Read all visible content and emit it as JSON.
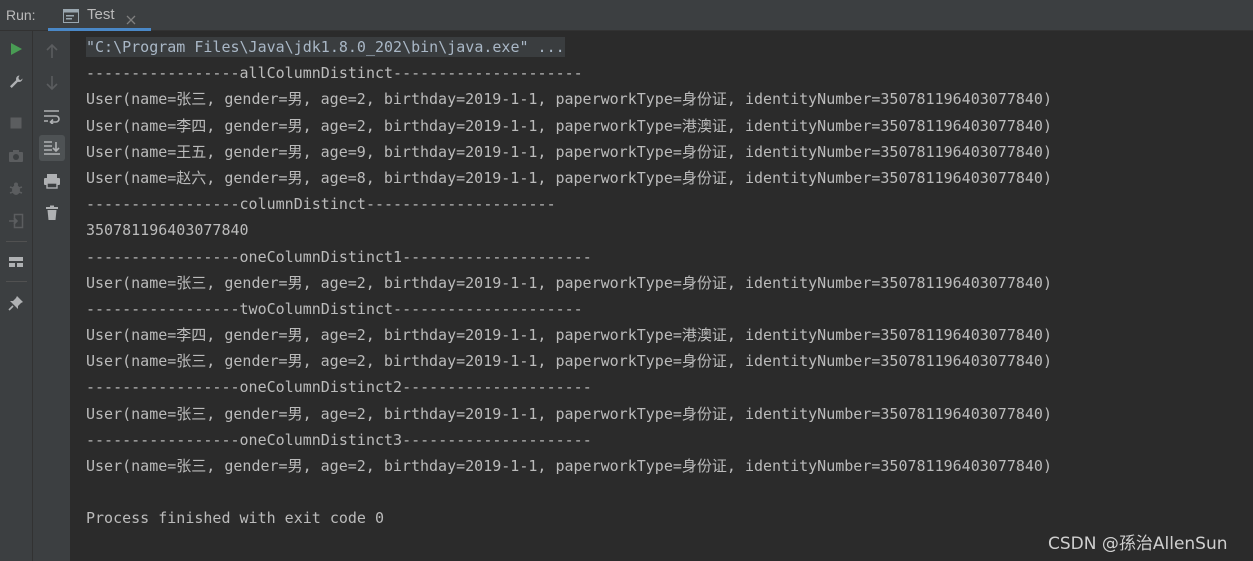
{
  "topbar": {
    "run_label": "Run:",
    "tab_title": "Test"
  },
  "toolbar_left": [
    "run-icon",
    "wrench-icon",
    "stop-icon",
    "camera-icon",
    "bug-settings-icon",
    "exit-icon",
    "layout-icon",
    "pin-icon"
  ],
  "toolbar_right": [
    "arrow-up-icon",
    "arrow-down-icon",
    "soft-wrap-icon",
    "scroll-to-end-icon",
    "print-icon",
    "trash-icon"
  ],
  "console": {
    "lines": [
      "\"C:\\Program Files\\Java\\jdk1.8.0_202\\bin\\java.exe\" ...",
      "-----------------allColumnDistinct---------------------",
      "User(name=张三, gender=男, age=2, birthday=2019-1-1, paperworkType=身份证, identityNumber=350781196403077840)",
      "User(name=李四, gender=男, age=2, birthday=2019-1-1, paperworkType=港澳证, identityNumber=350781196403077840)",
      "User(name=王五, gender=男, age=9, birthday=2019-1-1, paperworkType=身份证, identityNumber=350781196403077840)",
      "User(name=赵六, gender=男, age=8, birthday=2019-1-1, paperworkType=身份证, identityNumber=350781196403077840)",
      "-----------------columnDistinct---------------------",
      "350781196403077840",
      "-----------------oneColumnDistinct1---------------------",
      "User(name=张三, gender=男, age=2, birthday=2019-1-1, paperworkType=身份证, identityNumber=350781196403077840)",
      "-----------------twoColumnDistinct---------------------",
      "User(name=李四, gender=男, age=2, birthday=2019-1-1, paperworkType=港澳证, identityNumber=350781196403077840)",
      "User(name=张三, gender=男, age=2, birthday=2019-1-1, paperworkType=身份证, identityNumber=350781196403077840)",
      "-----------------oneColumnDistinct2---------------------",
      "User(name=张三, gender=男, age=2, birthday=2019-1-1, paperworkType=身份证, identityNumber=350781196403077840)",
      "-----------------oneColumnDistinct3---------------------",
      "User(name=张三, gender=男, age=2, birthday=2019-1-1, paperworkType=身份证, identityNumber=350781196403077840)",
      "",
      "Process finished with exit code 0"
    ]
  },
  "watermark": "CSDN @孫治AllenSun",
  "colors": {
    "background": "#2b2b2b",
    "toolbar": "#3c3f41",
    "text": "#bbbbbb",
    "run_green": "#499c54",
    "tab_underline": "#4a88c7"
  }
}
